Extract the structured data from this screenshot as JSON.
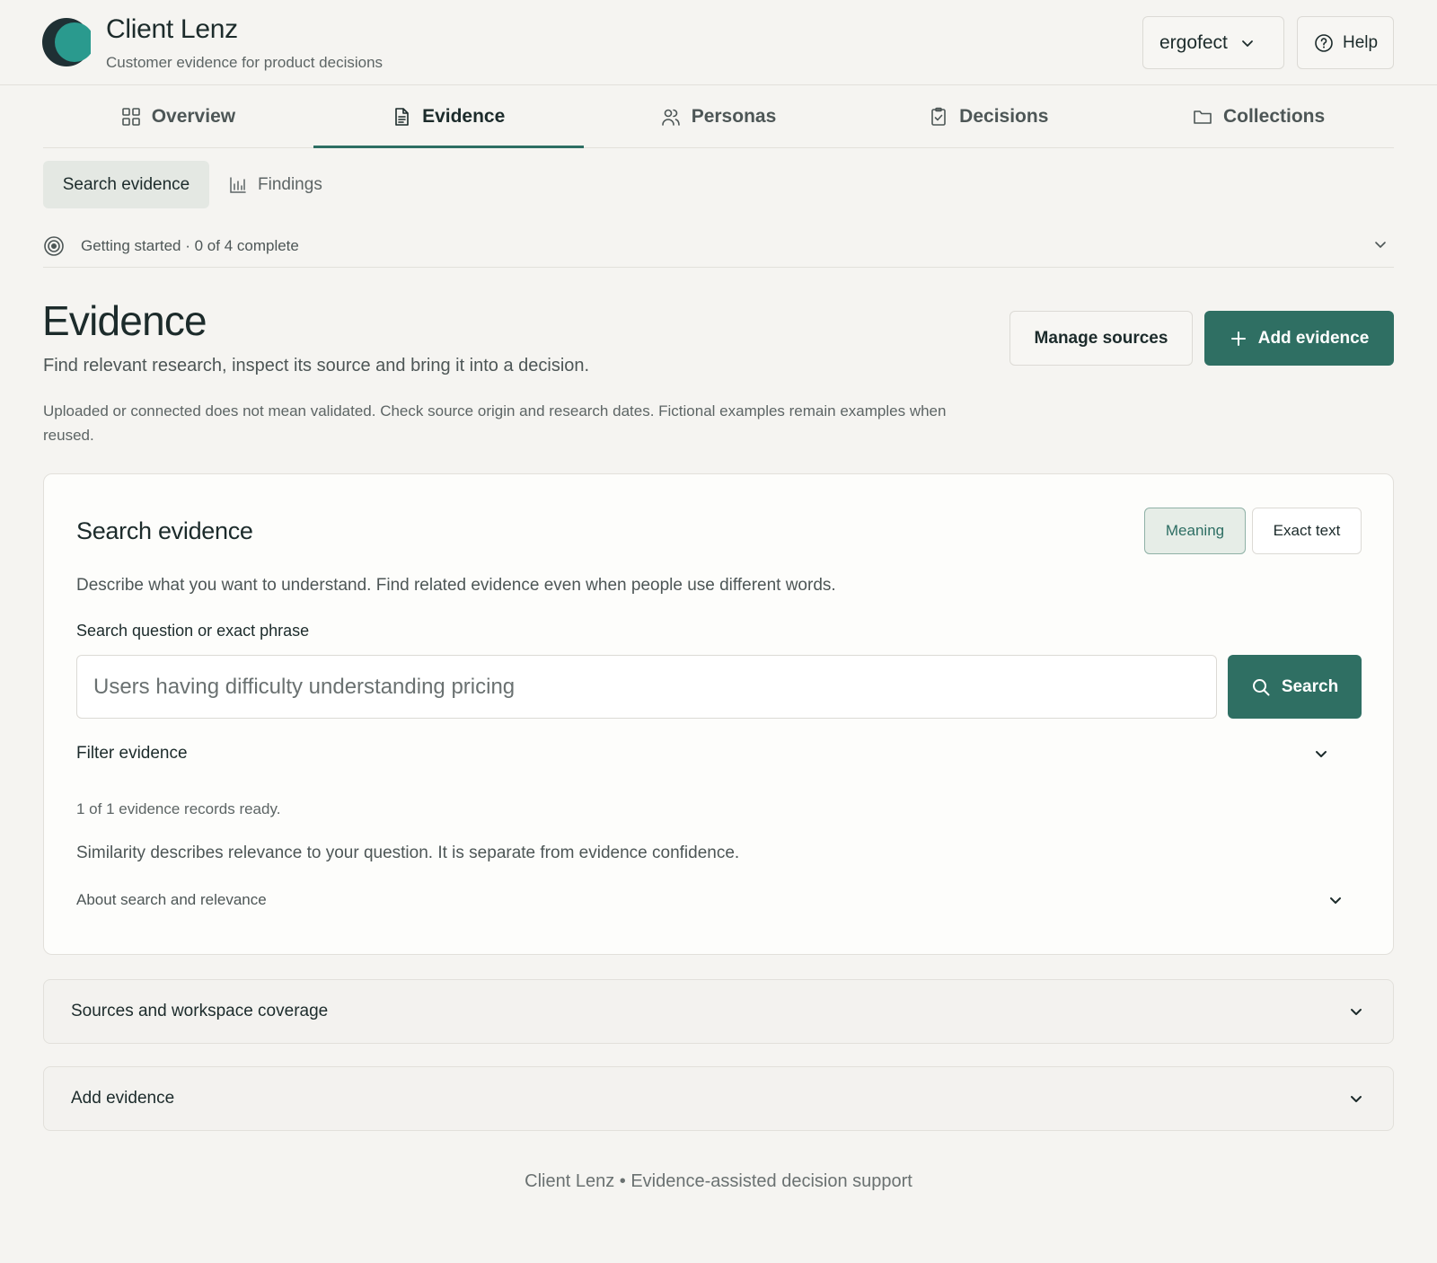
{
  "app": {
    "title": "Client Lenz",
    "subtitle": "Customer evidence for product decisions",
    "workspace": "ergofect",
    "help_label": "Help"
  },
  "nav": {
    "tabs": [
      {
        "label": "Overview",
        "icon": "grid-icon"
      },
      {
        "label": "Evidence",
        "icon": "document-icon",
        "active": true
      },
      {
        "label": "Personas",
        "icon": "users-icon"
      },
      {
        "label": "Decisions",
        "icon": "clipboard-check-icon"
      },
      {
        "label": "Collections",
        "icon": "folder-icon"
      }
    ]
  },
  "subnav": {
    "search_label": "Search evidence",
    "findings_label": "Findings"
  },
  "getting_started": {
    "label": "Getting started · 0 of 4 complete"
  },
  "page": {
    "title": "Evidence",
    "subtitle": "Find relevant research, inspect its source and bring it into a decision.",
    "note": "Uploaded or connected does not mean validated. Check source origin and research dates. Fictional examples remain examples when reused.",
    "manage_sources_label": "Manage sources",
    "add_evidence_label": "Add evidence"
  },
  "search": {
    "title": "Search evidence",
    "mode_meaning": "Meaning",
    "mode_exact": "Exact text",
    "description": "Describe what you want to understand. Find related evidence even when people use different words.",
    "field_label": "Search question or exact phrase",
    "placeholder": "Users having difficulty understanding pricing",
    "value": "",
    "button_label": "Search",
    "filter_label": "Filter evidence",
    "ready_text": "1 of 1 evidence records ready.",
    "similarity_text": "Similarity describes relevance to your question. It is separate from evidence confidence.",
    "about_label": "About search and relevance"
  },
  "panels": {
    "sources_label": "Sources and workspace coverage",
    "add_label": "Add evidence"
  },
  "footer": {
    "text": "Client Lenz • Evidence-assisted decision support"
  },
  "colors": {
    "accent": "#2f6f63",
    "accent_light": "#e6ede7",
    "background": "#f5f4f1",
    "card": "#fdfdfb",
    "text": "#1c2b2b",
    "muted": "#5d6565"
  }
}
